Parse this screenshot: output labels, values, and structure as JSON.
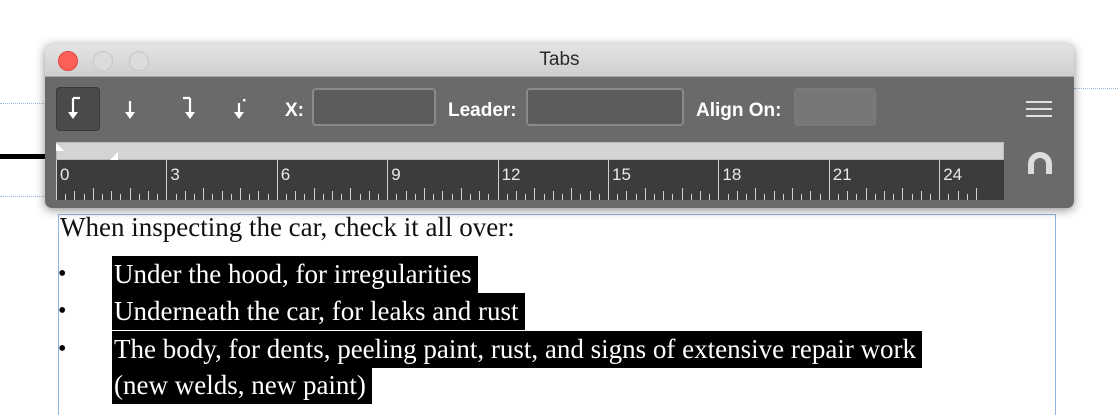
{
  "document": {
    "intro": "When inspecting the car, check it all over:",
    "bullets": [
      {
        "bullet": "•",
        "text": "Under the hood, for irregularities"
      },
      {
        "bullet": "•",
        "text": "Underneath the car, for leaks and rust"
      },
      {
        "bullet": "•",
        "text": "The body, for dents, peeling paint, rust, and signs of extensive repair work"
      }
    ],
    "continuation": "(new welds, new paint)"
  },
  "panel": {
    "title": "Tabs",
    "tools": [
      {
        "name": "left-justified-tab-icon",
        "active": true
      },
      {
        "name": "center-justified-tab-icon",
        "active": false
      },
      {
        "name": "right-justified-tab-icon",
        "active": false
      },
      {
        "name": "align-to-decimal-tab-icon",
        "active": false
      }
    ],
    "x_label": "X:",
    "x_value": "",
    "leader_label": "Leader:",
    "leader_value": "",
    "align_on_label": "Align On:",
    "align_on_value": "",
    "ruler_labels": [
      "0",
      "3",
      "6",
      "9",
      "12",
      "15",
      "18",
      "21",
      "24"
    ],
    "colors": {
      "close": "#fc5f57",
      "panel": "#6a6a6a",
      "ruler": "#3c3c3c"
    }
  }
}
